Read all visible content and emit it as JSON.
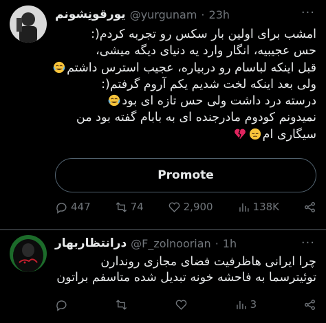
{
  "tweet1": {
    "display_name": "یورقونِشونم",
    "handle": "@yurgunam",
    "dot": "·",
    "time": "23h",
    "more": "···",
    "lines": [
      "امشب برای اولین بار سکس رو تجربه کردم(:",
      "حس عجیبیه، انگار وارد یه دنیای دیگه میشی،",
      "قبل اینکه لباسام رو دربیاره، عجیب استرس داشتم",
      "ولی بعد اینکه لخت شدیم یکم آروم گرفتم(:",
      "درسته درد داشت ولی حس تازه ای بود",
      "نمیدونم کودوم مادرجنده ای به بابام گفته بود من",
      "سیگاری ام"
    ],
    "promote_label": "Promote",
    "stats": {
      "replies": "447",
      "retweets": "74",
      "likes": "2,900",
      "views": "138K"
    }
  },
  "tweet2": {
    "display_name": "درانتظاربهار",
    "handle": "@F_zolnoorian",
    "dot": "·",
    "time": "1h",
    "more": "···",
    "lines": [
      "چرا ایرانی هاظرفیت فضای مجازی روندارن",
      "توئیترسما به فاحشه خونه تبدیل شده متاسفم براتون"
    ],
    "stats": {
      "views": "3"
    }
  },
  "colors": {
    "background": "#000000",
    "text": "#e7e9ea",
    "muted": "#71767b",
    "border": "#2f3336"
  }
}
